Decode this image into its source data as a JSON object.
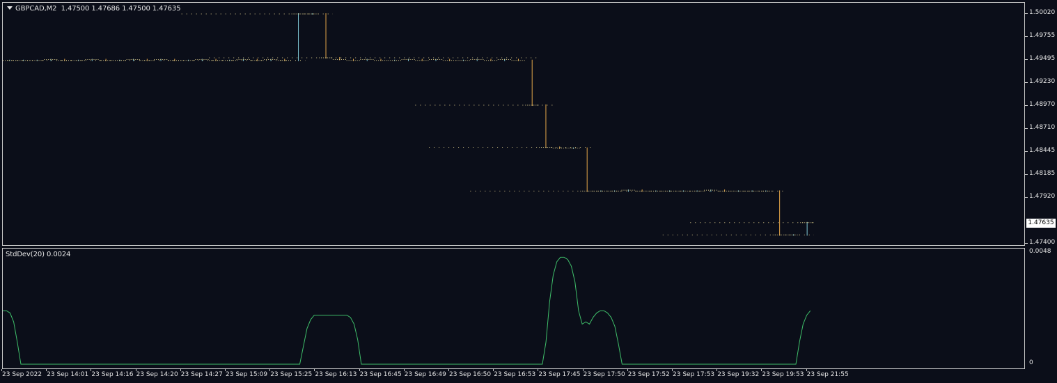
{
  "header": {
    "symbol": "GBPCAD,M2",
    "ohlc": "1.47500 1.47686 1.47500 1.47635"
  },
  "price_axis": {
    "labels": [
      "1.50020",
      "1.49755",
      "1.49495",
      "1.49230",
      "1.48970",
      "1.48710",
      "1.48445",
      "1.48185",
      "1.47920",
      "1.47400"
    ],
    "current_price": "1.47635"
  },
  "indicator": {
    "label": "StdDev(20) 0.0024",
    "axis_labels": [
      "0.0048",
      "0"
    ]
  },
  "time_axis": {
    "labels": [
      "23 Sep 2022",
      "23 Sep 14:01",
      "23 Sep 14:16",
      "23 Sep 14:20",
      "23 Sep 14:27",
      "23 Sep 15:09",
      "23 Sep 15:25",
      "23 Sep 16:13",
      "23 Sep 16:45",
      "23 Sep 16:49",
      "23 Sep 16:50",
      "23 Sep 16:53",
      "23 Sep 17:45",
      "23 Sep 17:50",
      "23 Sep 17:52",
      "23 Sep 17:53",
      "23 Sep 19:32",
      "23 Sep 19:53",
      "23 Sep 21:55"
    ]
  },
  "colors": {
    "background": "#0b0e19",
    "bull": "#7fc7d6",
    "bear": "#e6a84a",
    "dots": "#d8c88a",
    "stddev": "#3fbf6a",
    "frame": "#c8c8c8",
    "text": "#e6e6e6"
  },
  "chart_data": [
    {
      "type": "line",
      "title": "GBPCAD,M2",
      "ylim": [
        1.474,
        1.5002
      ],
      "note_series": "price levels (bar trace, approximate)",
      "series": [
        {
          "values": [
            1.4949,
            1.4949,
            1.4949,
            1.495,
            1.4949,
            1.4949,
            1.495,
            1.4949,
            1.4949,
            1.495,
            1.4949,
            1.495,
            1.4949,
            1.4949,
            1.495,
            1.4949,
            1.4949,
            1.495,
            1.4949,
            1.495,
            1.4949,
            1.5002,
            1.5002,
            1.4952,
            1.495,
            1.4949,
            1.495,
            1.4949,
            1.4949,
            1.495,
            1.4949,
            1.495,
            1.4949,
            1.4949,
            1.495,
            1.4949,
            1.495,
            1.4949,
            1.4898,
            1.485,
            1.4849,
            1.4849,
            1.48,
            1.48,
            1.48,
            1.4801,
            1.48,
            1.48,
            1.48,
            1.48,
            1.48,
            1.4801,
            1.48,
            1.48,
            1.48,
            1.48,
            1.475,
            1.475,
            1.4764
          ]
        }
      ]
    },
    {
      "type": "line",
      "title": "StdDev(20) 0.0024",
      "ylim": [
        0,
        0.005
      ],
      "series": [
        {
          "values": [
            0.0024,
            0.0024,
            0.0023,
            0.0019,
            0.001,
            0,
            0,
            0,
            0,
            0,
            0,
            0,
            0,
            0,
            0,
            0,
            0,
            0,
            0,
            0,
            0,
            0,
            0,
            0,
            0,
            0,
            0,
            0,
            0,
            0,
            0,
            0,
            0,
            0,
            0,
            0,
            0,
            0,
            0,
            0,
            0,
            0,
            0,
            0,
            0,
            0,
            0,
            0,
            0,
            0,
            0,
            0,
            0,
            0,
            0,
            0,
            0,
            0,
            0,
            0,
            0,
            0,
            0,
            0,
            0,
            0,
            0,
            0,
            0,
            0,
            0,
            0,
            0,
            0,
            0,
            0,
            0,
            0,
            0,
            0,
            0,
            0,
            0,
            0.0008,
            0.0016,
            0.002,
            0.0022,
            0.0022,
            0.0022,
            0.0022,
            0.0022,
            0.0022,
            0.0022,
            0.0022,
            0.0022,
            0.0022,
            0.0021,
            0.0018,
            0.0011,
            0,
            0,
            0,
            0,
            0,
            0,
            0,
            0,
            0,
            0,
            0,
            0,
            0,
            0,
            0,
            0,
            0,
            0,
            0,
            0,
            0,
            0,
            0,
            0,
            0,
            0,
            0,
            0,
            0,
            0,
            0,
            0,
            0,
            0,
            0,
            0,
            0,
            0,
            0,
            0,
            0,
            0,
            0,
            0,
            0,
            0,
            0,
            0,
            0,
            0,
            0,
            0.001,
            0.0028,
            0.004,
            0.0046,
            0.0048,
            0.0048,
            0.0047,
            0.0044,
            0.0037,
            0.0024,
            0.0018,
            0.0019,
            0.0018,
            0.0021,
            0.0023,
            0.0024,
            0.0024,
            0.0023,
            0.0021,
            0.0017,
            0.0009,
            0,
            0,
            0,
            0,
            0,
            0,
            0,
            0,
            0,
            0,
            0,
            0,
            0,
            0,
            0,
            0,
            0,
            0,
            0,
            0,
            0,
            0,
            0,
            0,
            0,
            0,
            0,
            0,
            0,
            0,
            0,
            0,
            0,
            0,
            0,
            0,
            0,
            0,
            0,
            0,
            0,
            0,
            0,
            0,
            0,
            0,
            0,
            0,
            0,
            0.001,
            0.0018,
            0.0022,
            0.0024
          ]
        }
      ]
    }
  ]
}
